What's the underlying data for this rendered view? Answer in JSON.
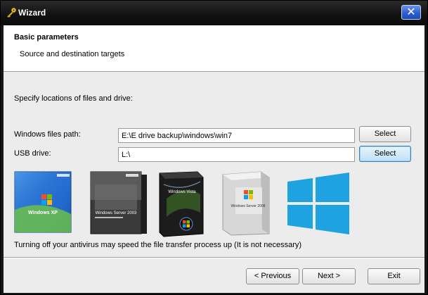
{
  "window": {
    "title": "Wizard",
    "close_symbol": "✕",
    "icon": "key-icon"
  },
  "header": {
    "title": "Basic parameters",
    "subtitle": "Source and destination targets"
  },
  "main": {
    "instructions": "Specify locations of files and drive:",
    "windows_path": {
      "label": "Windows files path:",
      "value": "E:\\E drive backup\\windows\\win7",
      "button_label": "Select"
    },
    "usb_drive": {
      "label": "USB drive:",
      "value": "L:\\",
      "button_label": "Select"
    },
    "product_boxes": [
      {
        "name": "windows-xp-box",
        "label": "Windows XP"
      },
      {
        "name": "windows-server-2003-box",
        "label": "Windows Server 2003"
      },
      {
        "name": "windows-vista-box",
        "label": "Windows Vista"
      },
      {
        "name": "windows-server-2008-box",
        "label": "Windows Server 2008"
      },
      {
        "name": "windows-8-logo",
        "label": ""
      }
    ],
    "antivirus_note": "Turning off your antivirus may speed the file transfer process up (It is not necessary)"
  },
  "footer": {
    "previous_label": "< Previous",
    "next_label": "Next >",
    "exit_label": "Exit"
  },
  "colors": {
    "title_bar": "#111111",
    "close_button": "#2d5fd0",
    "win8_logo": "#1fa3e0",
    "focused_button": "#bfe1f7"
  }
}
